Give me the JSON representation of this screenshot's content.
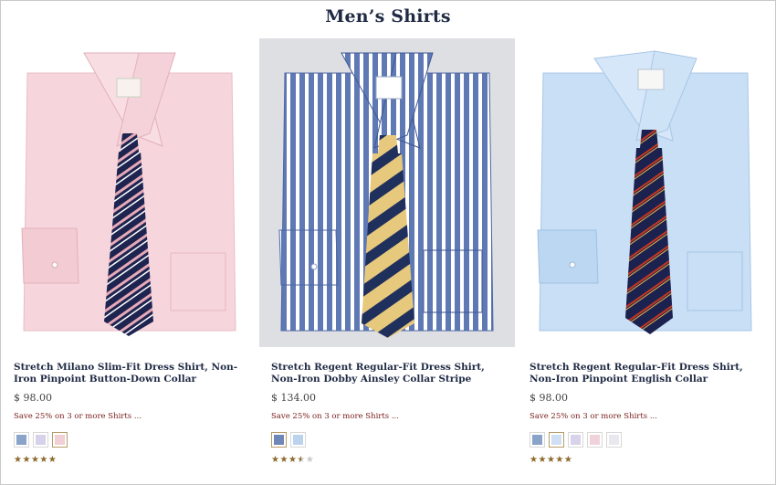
{
  "page": {
    "title": "Men’s Shirts"
  },
  "products": [
    {
      "name": "Stretch Milano Slim-Fit Dress Shirt, Non-Iron Pinpoint Button-Down Collar",
      "price": "$ 98.00",
      "promo": "Save 25% on 3 or more Shirts ...",
      "rating": 5,
      "stars": [
        "★",
        "★",
        "★",
        "★",
        "★"
      ],
      "swatches": [
        {
          "color": "#8aa3c9",
          "selected": false
        },
        {
          "color": "#d7d2ea",
          "selected": false
        },
        {
          "color": "#f1cfd6",
          "selected": true
        }
      ],
      "image": "pink-shirt-with-navy-pink-striped-tie"
    },
    {
      "name": "Stretch Regent Regular-Fit Dress Shirt, Non-Iron Dobby Ainsley Collar Stripe",
      "price": "$ 134.00",
      "promo": "Save 25% on 3 or more Shirts ...",
      "rating": 3.5,
      "stars": [
        "★",
        "★",
        "★",
        "★",
        "★"
      ],
      "swatches": [
        {
          "color": "#6e86b8",
          "selected": true
        },
        {
          "color": "#bcd3ee",
          "selected": false
        }
      ],
      "image": "blue-white-striped-shirt-with-gold-navy-duck-tie"
    },
    {
      "name": "Stretch Regent Regular-Fit Dress Shirt, Non-Iron Pinpoint English Collar",
      "price": "$ 98.00",
      "promo": "Save 25% on 3 or more Shirts ...",
      "rating": 5,
      "stars": [
        "★",
        "★",
        "★",
        "★",
        "★"
      ],
      "swatches": [
        {
          "color": "#8aa3c9",
          "selected": false
        },
        {
          "color": "#cfe0f4",
          "selected": true
        },
        {
          "color": "#d8d2ea",
          "selected": false
        },
        {
          "color": "#f0d3da",
          "selected": false
        },
        {
          "color": "#e8e8ee",
          "selected": false
        }
      ],
      "image": "light-blue-shirt-with-navy-red-striped-tie"
    }
  ]
}
